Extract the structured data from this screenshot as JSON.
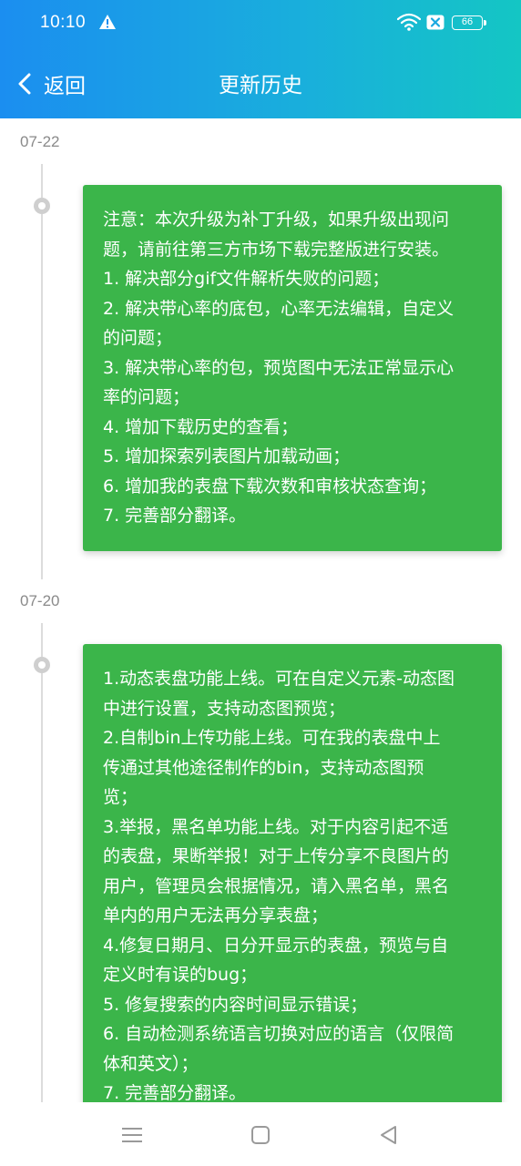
{
  "status_bar": {
    "time": "10:10",
    "battery": "66",
    "icons": [
      "warning-icon",
      "wifi-icon",
      "sim-icon",
      "battery-icon"
    ]
  },
  "nav": {
    "back_label": "返回",
    "title": "更新历史"
  },
  "colors": {
    "header_start": "#1b8ef0",
    "header_end": "#14c6c4",
    "card_green": "#3bb54a",
    "date_gray": "#8a8a8a"
  },
  "entries": [
    {
      "date": "07-22",
      "lines": [
        "注意：本次升级为补丁升级，如果升级出现问",
        "题，请前往第三方市场下载完整版进行安装。",
        "1. 解决部分gif文件解析失败的问题；",
        "2. 解决带心率的底包，心率无法编辑，自定义",
        "的问题；",
        "3. 解决带心率的包，预览图中无法正常显示心",
        "率的问题；",
        "4. 增加下载历史的查看；",
        "5. 增加探索列表图片加载动画；",
        "6. 增加我的表盘下载次数和审核状态查询；",
        "7. 完善部分翻译。"
      ]
    },
    {
      "date": "07-20",
      "lines": [
        "1.动态表盘功能上线。可在自定义元素-动态图",
        "中进行设置，支持动态图预览；",
        "2.自制bin上传功能上线。可在我的表盘中上",
        "传通过其他途径制作的bin，支持动态图预",
        "览；",
        "3.举报，黑名单功能上线。对于内容引起不适",
        "的表盘，果断举报！对于上传分享不良图片的",
        "用户，管理员会根据情况，请入黑名单，黑名",
        "单内的用户无法再分享表盘；",
        "4.修复日期月、日分开显示的表盘，预览与自",
        "定义时有误的bug；",
        "5. 修复搜索的内容时间显示错误；",
        "6. 自动检测系统语言切换对应的语言（仅限简",
        "体和英文）；",
        "7. 完善部分翻译。"
      ]
    }
  ]
}
